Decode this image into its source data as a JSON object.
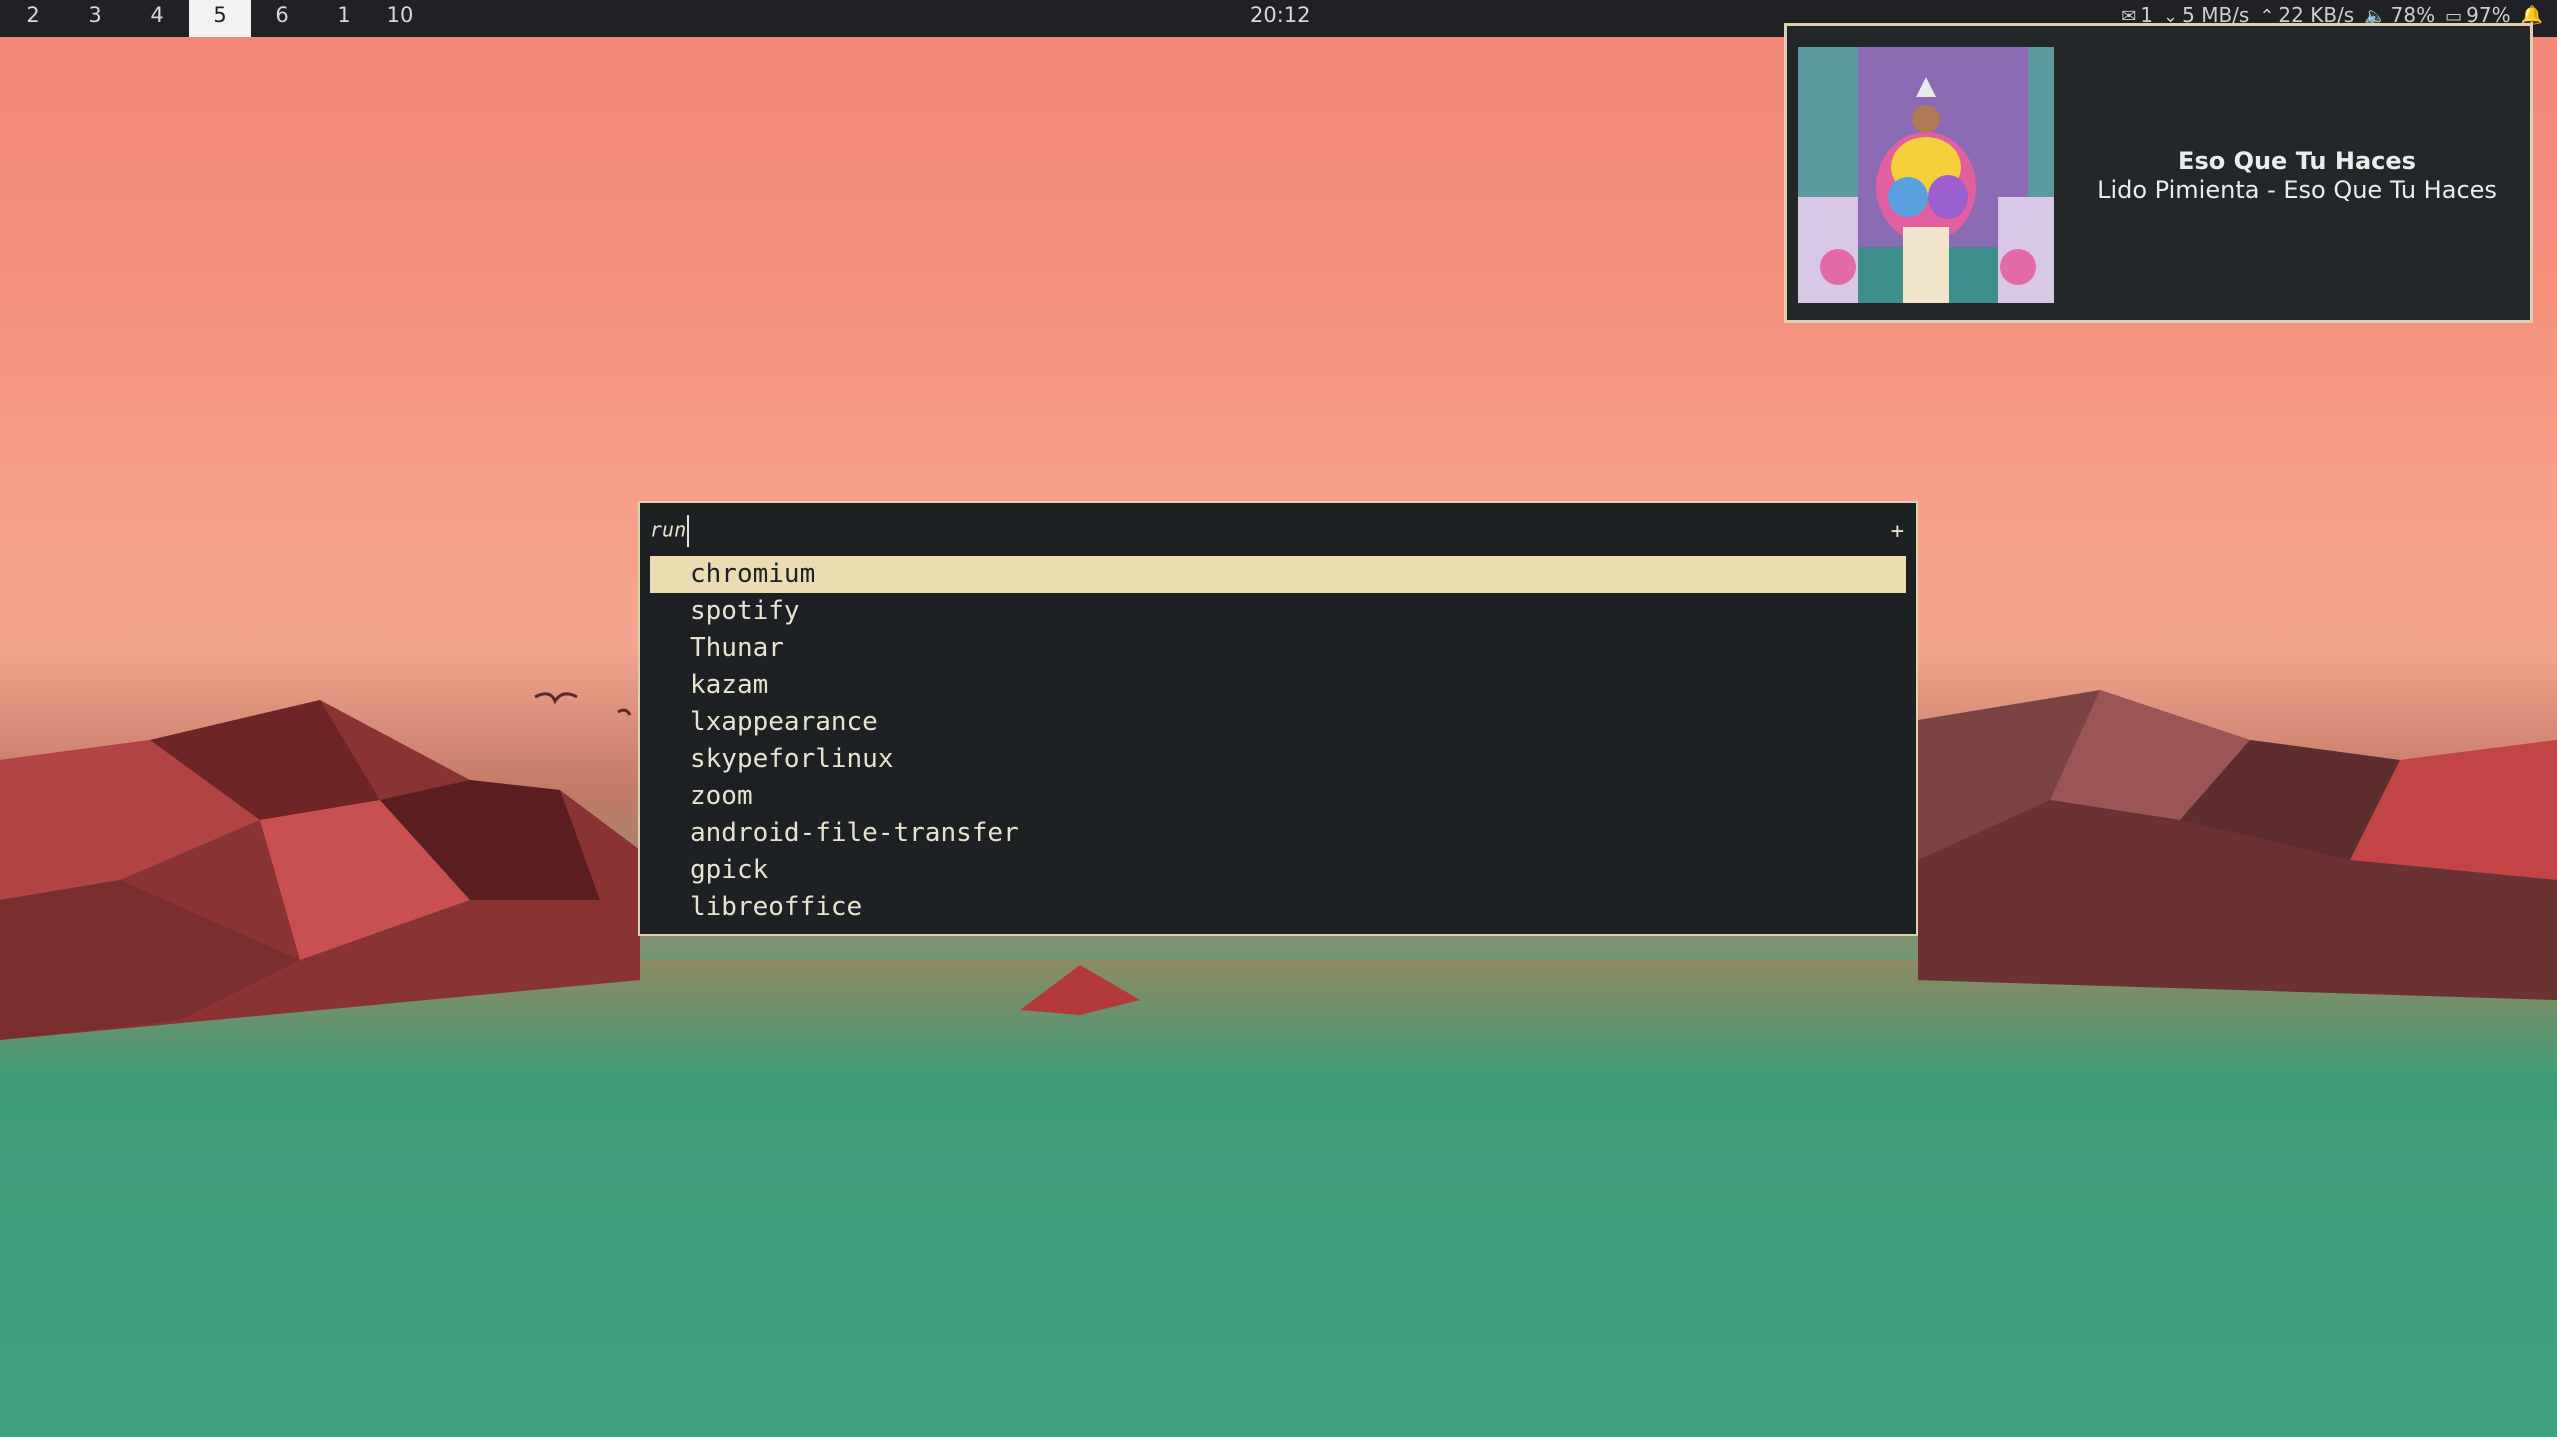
{
  "workspaces": [
    {
      "label": "2",
      "active": false
    },
    {
      "label": "3",
      "active": false
    },
    {
      "label": "4",
      "active": false
    },
    {
      "label": "5",
      "active": true
    },
    {
      "label": "6",
      "active": false
    },
    {
      "label": "1",
      "active": false
    },
    {
      "label": "10",
      "active": false
    }
  ],
  "clock": "20:12",
  "status": {
    "mail_count": "1",
    "download_speed": "5 MB/s",
    "upload_speed": "22 KB/s",
    "volume": "78%",
    "battery": "97%"
  },
  "icons": {
    "mail": "mail-icon",
    "download": "download-arrow-icon",
    "upload": "upload-arrow-icon",
    "volume": "volume-icon",
    "battery": "battery-icon",
    "bell": "bell-icon"
  },
  "notification": {
    "title": "Eso Que Tu Haces",
    "body": "Lido Pimienta - Eso Que Tu Haces"
  },
  "launcher": {
    "prompt": "run",
    "plus": "+",
    "selected_index": 0,
    "results": [
      "chromium",
      "spotify",
      "Thunar",
      "kazam",
      "lxappearance",
      "skypeforlinux",
      "zoom",
      "android-file-transfer",
      "gpick",
      "libreoffice"
    ]
  },
  "colors": {
    "bar_bg": "#1f2124",
    "launcher_bg": "#1e2123",
    "accent": "#ebdcb2",
    "text": "#e8e3d0"
  }
}
